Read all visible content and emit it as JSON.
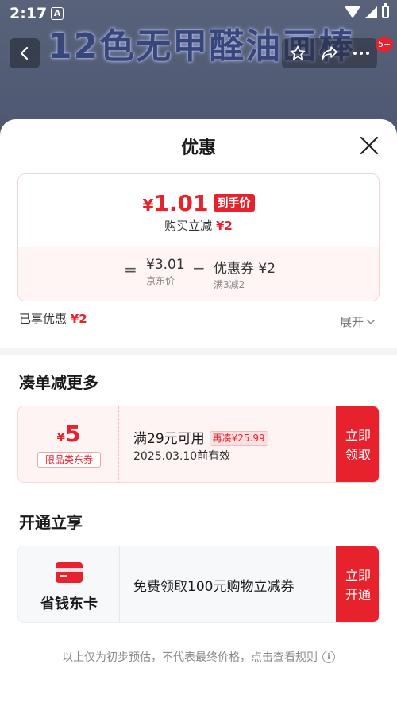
{
  "status_bar": {
    "time": "2:17",
    "notification_badge": "A"
  },
  "background_page": {
    "product_title": "12色无甲醛油画棒",
    "cart_badge": "5+"
  },
  "sheet": {
    "title": "优惠",
    "final_price": {
      "yen": "¥",
      "amount": "1.01",
      "tag": "到手价",
      "discount_label": "购买立减",
      "discount_value": "¥2"
    },
    "calculation": {
      "equals": "=",
      "base_price": "¥3.01",
      "base_price_label": "京东价",
      "minus": "−",
      "coupon_text": "优惠券 ¥2",
      "coupon_rule": "满3减2"
    },
    "enjoyed": {
      "label": "已享优惠",
      "value": "¥2"
    },
    "expand_label": "展开"
  },
  "section_more": {
    "title": "凑单减更多",
    "coupon": {
      "yen": "¥",
      "amount": "5",
      "type": "限品类东券",
      "condition": "满29元可用",
      "chip": "再凑¥25.99",
      "validity": "2025.03.10前有效",
      "button_line1": "立即",
      "button_line2": "领取"
    }
  },
  "section_open": {
    "title": "开通立享",
    "card": {
      "name": "省钱东卡",
      "description": "免费领取100元购物立减券",
      "button_line1": "立即",
      "button_line2": "开通"
    }
  },
  "footer": {
    "note": "以上仅为初步预估，不代表最终价格，点击查看规则",
    "info_icon": "i"
  },
  "colors": {
    "accent": "#e8222d",
    "coupon_bg": "#fff4f4",
    "vip_bg": "#f7f8fa"
  }
}
